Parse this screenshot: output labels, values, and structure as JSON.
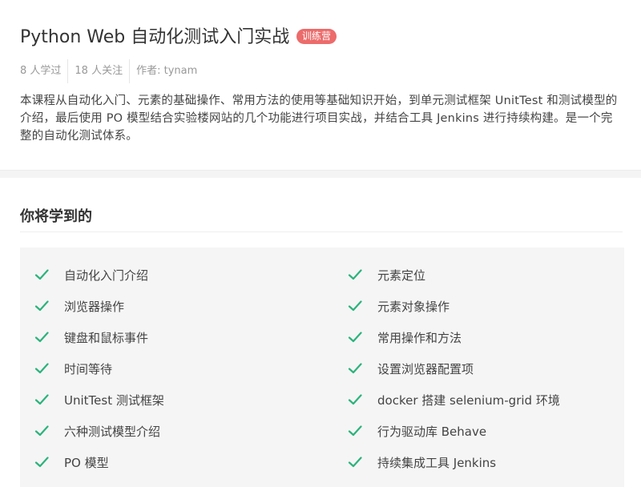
{
  "course": {
    "title": "Python Web 自动化测试入门实战",
    "badge": "训练营",
    "meta": {
      "learners": "8 人学过",
      "followers": "18 人关注",
      "author": "作者: tynam"
    },
    "description": "本课程从自动化入门、元素的基础操作、常用方法的使用等基础知识开始，到单元测试框架 UnitTest 和测试模型的介绍，最后使用 PO 模型结合实验楼网站的几个功能进行项目实战，并结合工具 Jenkins 进行持续构建。是一个完整的自动化测试体系。"
  },
  "learn": {
    "title": "你将学到的",
    "items_left": [
      "自动化入门介绍",
      "浏览器操作",
      "键盘和鼠标事件",
      "时间等待",
      "UnitTest 测试框架",
      "六种测试模型介绍",
      "PO 模型"
    ],
    "items_right": [
      "元素定位",
      "元素对象操作",
      "常用操作和方法",
      "设置浏览器配置项",
      "docker 搭建 selenium-grid 环境",
      "行为驱动库 Behave",
      "持续集成工具 Jenkins"
    ]
  },
  "colors": {
    "badge": "#ec6b6b",
    "check": "#2bb37c",
    "panel_bg": "#f5f5f5"
  },
  "icons": {
    "check": "check-icon"
  }
}
